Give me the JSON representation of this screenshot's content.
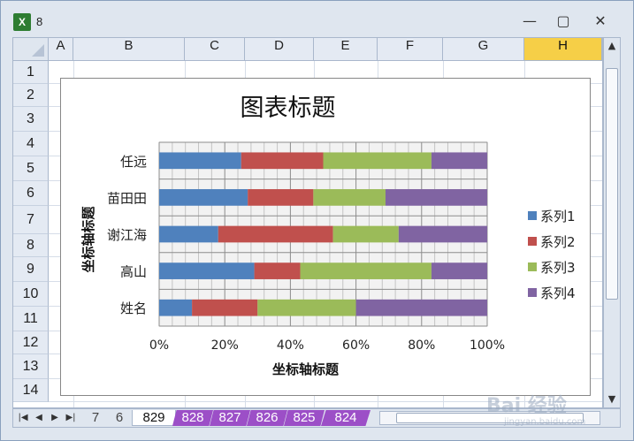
{
  "window": {
    "title": "8"
  },
  "columns": [
    "A",
    "B",
    "C",
    "D",
    "E",
    "F",
    "G",
    "H"
  ],
  "active_column": "H",
  "rows": [
    "1",
    "2",
    "3",
    "4",
    "5",
    "6",
    "7",
    "8",
    "9",
    "10",
    "11",
    "12",
    "13",
    "14"
  ],
  "sheet_tabs": [
    "7",
    "6",
    "829",
    "828",
    "827",
    "826",
    "825",
    "824"
  ],
  "active_tab": "829",
  "colors": {
    "series1": "#4f81bd",
    "series2": "#c0504d",
    "series3": "#9bbb59",
    "series4": "#8064a2",
    "tab_purple": "#9c4fc7"
  },
  "chart_data": {
    "type": "bar",
    "orientation": "horizontal",
    "stacking": "percent",
    "title": "图表标题",
    "xlabel": "坐标轴标题",
    "ylabel": "坐标轴标题",
    "categories": [
      "任远",
      "苗田田",
      "谢江海",
      "高山",
      "姓名"
    ],
    "series": [
      {
        "name": "系列1",
        "values": [
          25,
          27,
          18,
          29,
          10
        ]
      },
      {
        "name": "系列2",
        "values": [
          25,
          20,
          35,
          14,
          20
        ]
      },
      {
        "name": "系列3",
        "values": [
          33,
          22,
          20,
          40,
          30
        ]
      },
      {
        "name": "系列4",
        "values": [
          17,
          31,
          27,
          17,
          40
        ]
      }
    ],
    "xlim": [
      0,
      100
    ],
    "ticks": [
      "0%",
      "20%",
      "40%",
      "60%",
      "80%",
      "100%"
    ],
    "legend": "right",
    "grid": true
  },
  "watermark": {
    "text": "Bai 经验",
    "sub": "jingyan.baidu.com"
  }
}
